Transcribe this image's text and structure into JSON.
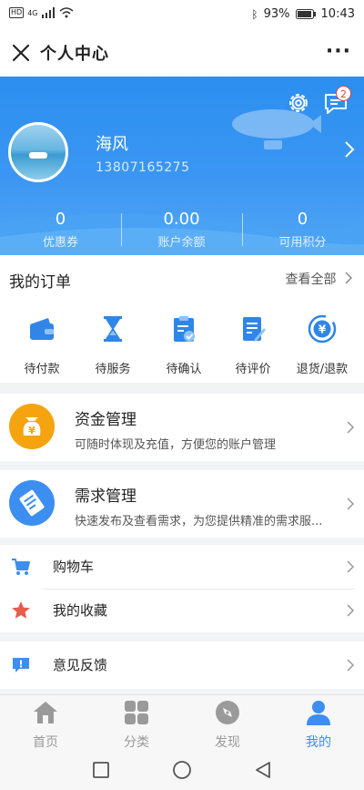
{
  "status_bar": {
    "network": "4G",
    "battery": "93%",
    "time": "10:43",
    "hd": "HD"
  },
  "header": {
    "title": "个人中心",
    "more": "···"
  },
  "profile": {
    "name": "海风",
    "phone": "13807165275",
    "message_badge": "2",
    "stats": [
      {
        "value": "0",
        "label": "优惠券"
      },
      {
        "value": "0.00",
        "label": "账户余额"
      },
      {
        "value": "0",
        "label": "可用积分"
      }
    ]
  },
  "orders": {
    "title": "我的订单",
    "view_all": "查看全部",
    "items": [
      {
        "label": "待付款",
        "icon": "wallet-icon"
      },
      {
        "label": "待服务",
        "icon": "hourglass-icon"
      },
      {
        "label": "待确认",
        "icon": "clipboard-check-icon"
      },
      {
        "label": "待评价",
        "icon": "edit-document-icon"
      },
      {
        "label": "退货/退款",
        "icon": "refund-icon"
      }
    ]
  },
  "funds": {
    "title": "资金管理",
    "desc": "可随时体现及充值，方便您的账户管理",
    "icon": "money-bag-icon"
  },
  "demand": {
    "title": "需求管理",
    "desc": "快速发布及查看需求，为您提供精准的需求服...",
    "icon": "document-icon"
  },
  "list": [
    {
      "label": "购物车",
      "icon": "cart-icon"
    },
    {
      "label": "我的收藏",
      "icon": "star-icon"
    }
  ],
  "feedback": {
    "label": "意见反馈",
    "icon": "feedback-icon"
  },
  "tabbar": [
    {
      "label": "首页",
      "icon": "home-icon"
    },
    {
      "label": "分类",
      "icon": "category-icon"
    },
    {
      "label": "发现",
      "icon": "compass-icon"
    },
    {
      "label": "我的",
      "icon": "user-icon"
    }
  ],
  "colors": {
    "primary": "#3c8ef0",
    "orange": "#f5a30f",
    "red": "#e85b4d"
  }
}
